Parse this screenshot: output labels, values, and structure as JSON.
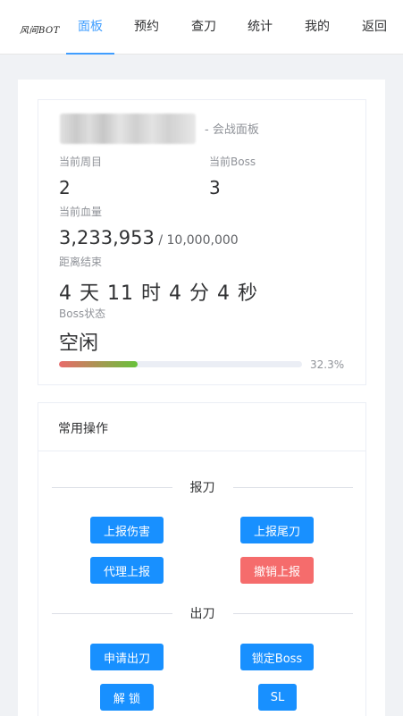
{
  "nav": {
    "logo": "风间BOT",
    "items": [
      "面板",
      "预约",
      "查刀",
      "统计",
      "我的",
      "返回"
    ],
    "active_index": 0
  },
  "panel": {
    "suffix": "- 会战面板",
    "round_label": "当前周目",
    "round_value": "2",
    "boss_label": "当前Boss",
    "boss_value": "3",
    "hp_label": "当前血量",
    "hp_current": "3,233,953",
    "hp_max": " / 10,000,000",
    "time_label": "距离结束",
    "time_value": "4 天 11 时 4 分 4 秒",
    "status_label": "Boss状态",
    "status_value": "空闲",
    "progress_percent": 32.3,
    "progress_text": "32.3%"
  },
  "ops": {
    "title": "常用操作",
    "report_section": "报刀",
    "report_damage": "上报伤害",
    "report_tail": "上报尾刀",
    "proxy_report": "代理上报",
    "cancel_report": "撤销上报",
    "attack_section": "出刀",
    "request_attack": "申请出刀",
    "lock_boss": "锁定Boss",
    "unlock": "解 锁",
    "sl": "SL"
  }
}
